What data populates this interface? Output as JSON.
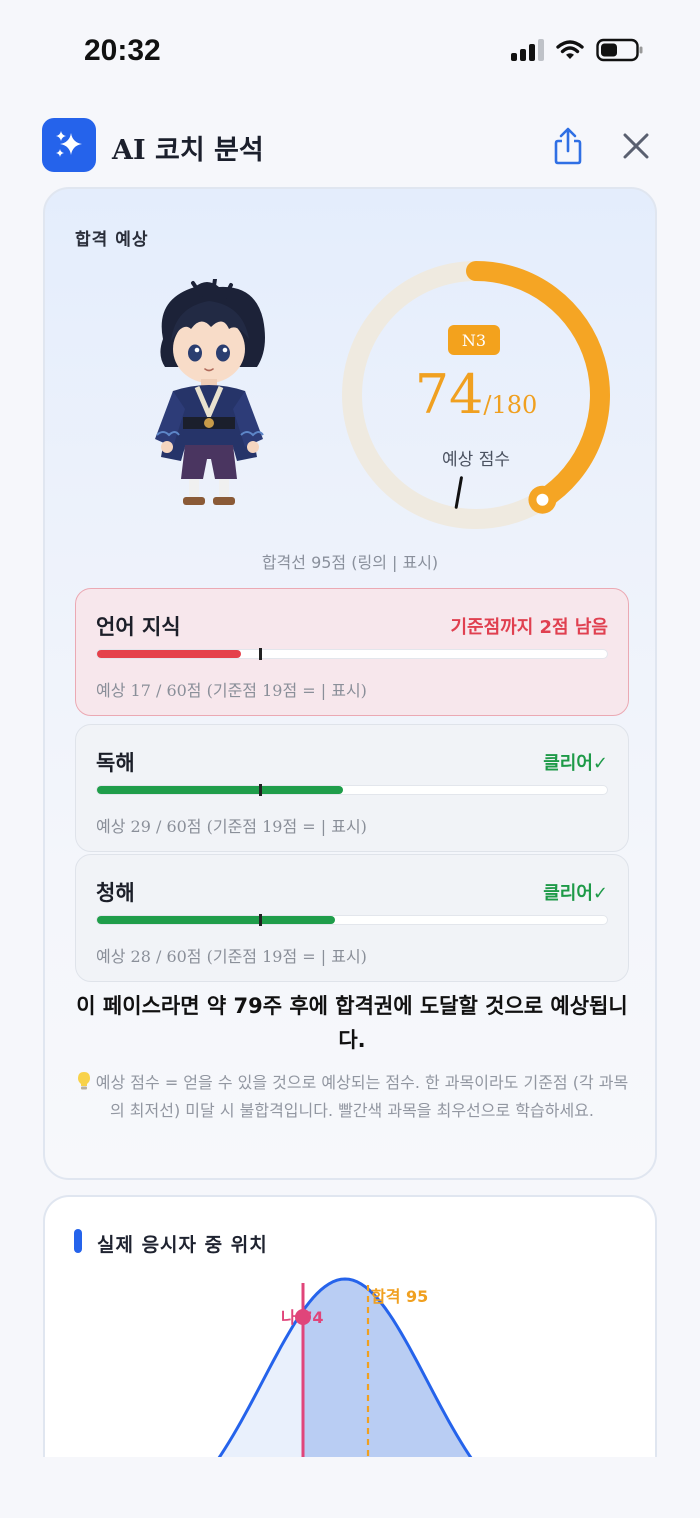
{
  "status_bar": {
    "time": "20:32",
    "icons": [
      "cellular-signal-icon",
      "wifi-icon",
      "battery-icon"
    ]
  },
  "header": {
    "title": "AI 코치 분석",
    "app_icon": "sparkle-icon",
    "share_icon": "share-icon",
    "close_icon": "close-icon",
    "accent_color": "#2563eb"
  },
  "prediction": {
    "label": "합격 예상",
    "level": "N3",
    "score": "74",
    "score_total": "/180",
    "score_fraction": 0.41,
    "score_caption": "예상 점수",
    "pass_line_text": "합격선 95점 (링의 | 표시)",
    "gauge_color": "#f5a524"
  },
  "subjects": [
    {
      "name": "언어 지식",
      "status": "기준점까지 2점 남음",
      "status_type": "warn",
      "fill_fraction": 0.283,
      "threshold_fraction": 0.317,
      "fill_color": "#e5414b",
      "detail": "예상 17 / 60점 (기준점 19점 = | 표시)"
    },
    {
      "name": "독해",
      "status": "클리어✓",
      "status_type": "ok",
      "fill_fraction": 0.483,
      "threshold_fraction": 0.317,
      "fill_color": "#1f9d4a",
      "detail": "예상 29 / 60점 (기준점 19점 = | 표시)"
    },
    {
      "name": "청해",
      "status": "클리어✓",
      "status_type": "ok",
      "fill_fraction": 0.467,
      "threshold_fraction": 0.317,
      "fill_color": "#1f9d4a",
      "detail": "예상 28 / 60점 (기준점 19점 = | 표시)"
    }
  ],
  "pace_text": "이 페이스라면 약 79주 후에 합격권에 도달할 것으로 예상됩니다.",
  "tip": {
    "icon": "lightbulb-icon",
    "text": "예상 점수 = 얻을 수 있을 것으로 예상되는 점수. 한 과목이라도 기준점 (각 과목의 최저선) 미달 시 불합격입니다. 빨간색 과목을 최우선으로 학습하세요."
  },
  "position": {
    "title": "실제 응시자 중 위치",
    "me_label": "나 74",
    "pass_label": "합격 95",
    "me_score": 74,
    "pass_score": 95
  }
}
